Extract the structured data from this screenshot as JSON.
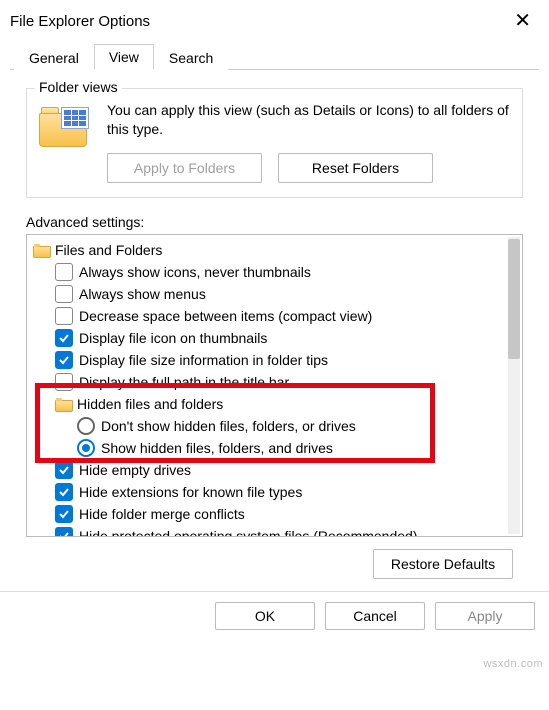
{
  "title": "File Explorer Options",
  "close_glyph": "✕",
  "tabs": {
    "general": "General",
    "view": "View",
    "search": "Search"
  },
  "folder_views": {
    "title": "Folder views",
    "desc": "You can apply this view (such as Details or Icons) to all folders of this type.",
    "apply": "Apply to Folders",
    "reset": "Reset Folders"
  },
  "advanced_label": "Advanced settings:",
  "tree": {
    "root_label": "Files and Folders",
    "items": [
      {
        "type": "chk",
        "checked": false,
        "label": "Always show icons, never thumbnails"
      },
      {
        "type": "chk",
        "checked": false,
        "label": "Always show menus"
      },
      {
        "type": "chk",
        "checked": false,
        "label": "Decrease space between items (compact view)"
      },
      {
        "type": "chk",
        "checked": true,
        "label": "Display file icon on thumbnails"
      },
      {
        "type": "chk",
        "checked": true,
        "label": "Display file size information in folder tips"
      },
      {
        "type": "chk",
        "checked": false,
        "label": "Display the full path in the title bar"
      }
    ],
    "hidden_group": {
      "label": "Hidden files and folders",
      "opt1": "Don't show hidden files, folders, or drives",
      "opt2": "Show hidden files, folders, and drives"
    },
    "after": [
      {
        "type": "chk",
        "checked": true,
        "label": "Hide empty drives"
      },
      {
        "type": "chk",
        "checked": true,
        "label": "Hide extensions for known file types"
      },
      {
        "type": "chk",
        "checked": true,
        "label": "Hide folder merge conflicts"
      },
      {
        "type": "chk",
        "checked": true,
        "label": "Hide protected operating system files (Recommended)"
      }
    ]
  },
  "restore_defaults": "Restore Defaults",
  "buttons": {
    "ok": "OK",
    "cancel": "Cancel",
    "apply": "Apply"
  },
  "watermark": "wsxdn.com"
}
